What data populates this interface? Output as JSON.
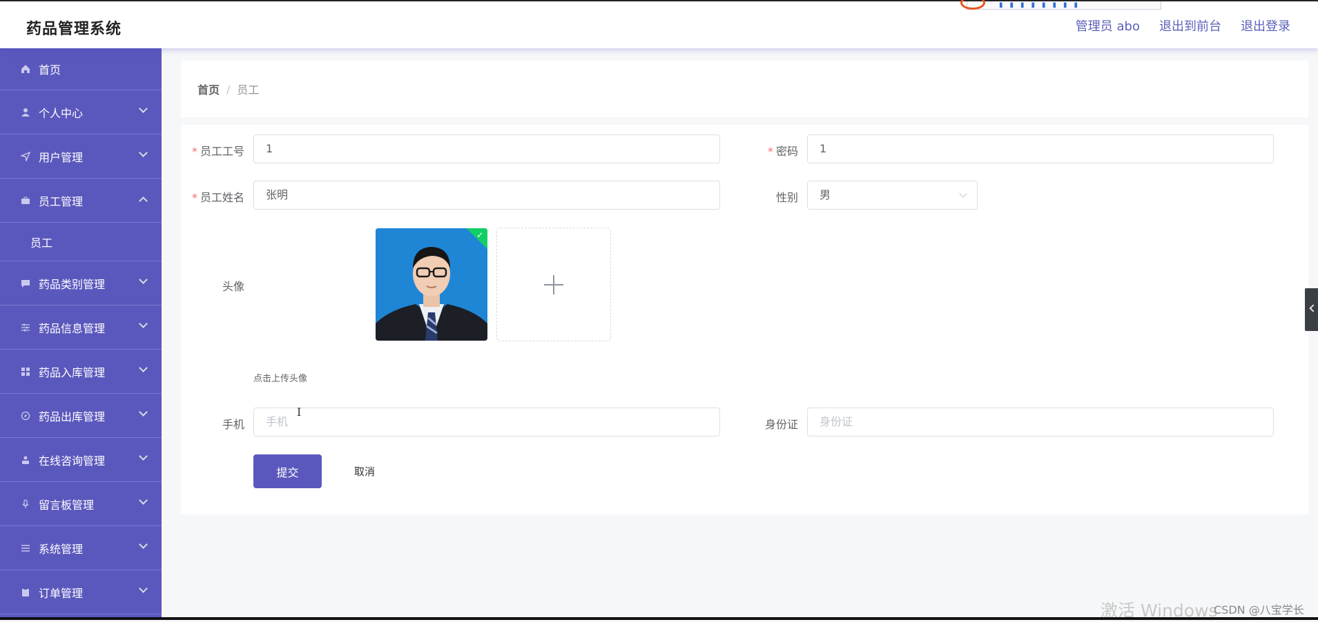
{
  "app": {
    "title": "药品管理系统"
  },
  "header": {
    "nav": [
      "管理员 abo",
      "退出到前台",
      "退出登录"
    ]
  },
  "sidebar": {
    "items": [
      {
        "label": "首页",
        "icon": "home-icon"
      },
      {
        "label": "个人中心",
        "icon": "user-icon"
      },
      {
        "label": "用户管理",
        "icon": "send-icon"
      },
      {
        "label": "员工管理",
        "icon": "briefcase-icon",
        "expanded": true,
        "children": [
          "员工"
        ]
      },
      {
        "label": "药品类别管理",
        "icon": "chat-icon"
      },
      {
        "label": "药品信息管理",
        "icon": "sliders-icon"
      },
      {
        "label": "药品入库管理",
        "icon": "grid-icon"
      },
      {
        "label": "药品出库管理",
        "icon": "compass-icon"
      },
      {
        "label": "在线咨询管理",
        "icon": "person-icon"
      },
      {
        "label": "留言板管理",
        "icon": "mic-icon"
      },
      {
        "label": "系统管理",
        "icon": "list-icon"
      },
      {
        "label": "订单管理",
        "icon": "clipboard-icon"
      }
    ]
  },
  "breadcrumb": {
    "home": "首页",
    "separator": "/",
    "current": "员工"
  },
  "form": {
    "employee_no": {
      "label": "员工工号",
      "value": "1",
      "required": true
    },
    "password": {
      "label": "密码",
      "value": "1",
      "required": true
    },
    "employee_name": {
      "label": "员工姓名",
      "value": "张明",
      "required": true
    },
    "gender": {
      "label": "性别",
      "value": "男"
    },
    "avatar": {
      "label": "头像",
      "tip": "点击上传头像"
    },
    "phone": {
      "label": "手机",
      "placeholder": "手机"
    },
    "id_card": {
      "label": "身份证",
      "placeholder": "身份证"
    },
    "submit_label": "提交",
    "cancel_label": "取消"
  },
  "watermark": {
    "text": "激活 Windows",
    "csdn": "CSDN @八宝学长"
  },
  "colors": {
    "accent": "#5b58bd",
    "required": "#f56c6c",
    "success": "#13ce66"
  }
}
